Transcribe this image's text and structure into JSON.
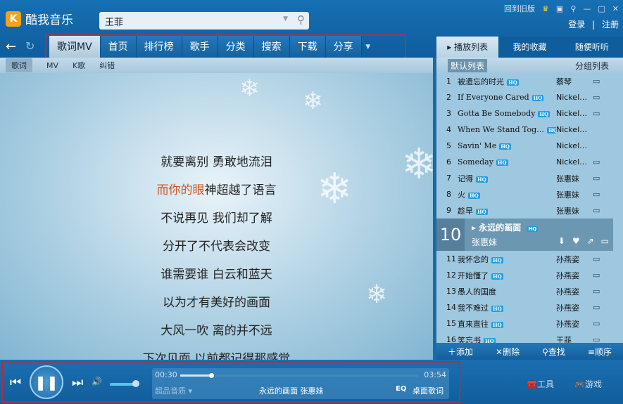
{
  "app": {
    "title": "酷我音乐",
    "logo_text": "K"
  },
  "search": {
    "value": "王菲"
  },
  "window": {
    "old_version": "回到旧版",
    "login": "登录",
    "separator": "|",
    "register": "注册"
  },
  "nav": {
    "tabs": [
      "歌词MV",
      "首页",
      "排行榜",
      "歌手",
      "分类",
      "搜索",
      "下载",
      "分享"
    ],
    "active": 0
  },
  "subnav": {
    "items": [
      "歌词",
      "MV",
      "K歌",
      "纠错"
    ],
    "active": 0
  },
  "lyrics": {
    "lines": [
      "就要离别 勇敢地流泪",
      "神超越了语言",
      "不说再见 我们却了解",
      "分开了不代表会改变",
      "谁需要谁 白云和蓝天",
      "以为才有美好的画面",
      "大风一吹 离的并不远",
      "下次见面 以前都记得那感觉"
    ],
    "current_highlight": "而你的眼",
    "highlight_color": "#d0561a"
  },
  "playlist": {
    "tabs": [
      "播放列表",
      "我的收藏",
      "随便听听"
    ],
    "sub": {
      "default": "默认列表",
      "group": "分组列表"
    },
    "songs": [
      {
        "n": "1",
        "title": "被遗忘的时光",
        "artist": "蔡琴",
        "hq": true,
        "mv": true
      },
      {
        "n": "2",
        "title": "If Everyone Cared",
        "artist": "Nickel…",
        "hq": true,
        "mv": true
      },
      {
        "n": "3",
        "title": "Gotta Be Somebody",
        "artist": "Nickel…",
        "hq": true,
        "mv": true
      },
      {
        "n": "4",
        "title": "When We Stand Tog…",
        "artist": "Nickel…",
        "hq": true,
        "mv": false
      },
      {
        "n": "5",
        "title": "Savin' Me",
        "artist": "Nickel…",
        "hq": true,
        "mv": false
      },
      {
        "n": "6",
        "title": "Someday",
        "artist": "Nickel…",
        "hq": true,
        "mv": true
      },
      {
        "n": "7",
        "title": "记得",
        "artist": "张惠妹",
        "hq": true,
        "mv": true
      },
      {
        "n": "8",
        "title": "火",
        "artist": "张惠妹",
        "hq": true,
        "mv": true
      },
      {
        "n": "9",
        "title": "趁早",
        "artist": "张惠妹",
        "hq": true,
        "mv": true
      }
    ],
    "current": {
      "n": "10",
      "title": "永远的画面",
      "artist": "张惠妹"
    },
    "songs_after": [
      {
        "n": "11",
        "title": "我怀念的",
        "artist": "孙燕姿",
        "hq": true,
        "mv": true
      },
      {
        "n": "12",
        "title": "开始懂了",
        "artist": "孙燕姿",
        "hq": true,
        "mv": true
      },
      {
        "n": "13",
        "title": "愚人的国度",
        "artist": "孙燕姿",
        "hq": false,
        "mv": true
      },
      {
        "n": "14",
        "title": "我不难过",
        "artist": "孙燕姿",
        "hq": true,
        "mv": true
      },
      {
        "n": "15",
        "title": "直来直往",
        "artist": "孙燕姿",
        "hq": true,
        "mv": true
      },
      {
        "n": "16",
        "title": "笑忘书",
        "artist": "王菲",
        "hq": true,
        "mv": true
      }
    ],
    "hq_label": "HQ",
    "footer": {
      "add": "添加",
      "delete": "删除",
      "find": "查找",
      "order": "顺序"
    }
  },
  "player": {
    "elapsed": "00:30",
    "total": "03:54",
    "progress": 0.13,
    "volume": 0.85,
    "quality": "超品音质",
    "now_playing": "永远的画面 张惠妹",
    "eq": "EQ",
    "desktop_lyrics": "桌面歌词"
  },
  "tools": {
    "tools": "工具",
    "games": "游戏"
  }
}
